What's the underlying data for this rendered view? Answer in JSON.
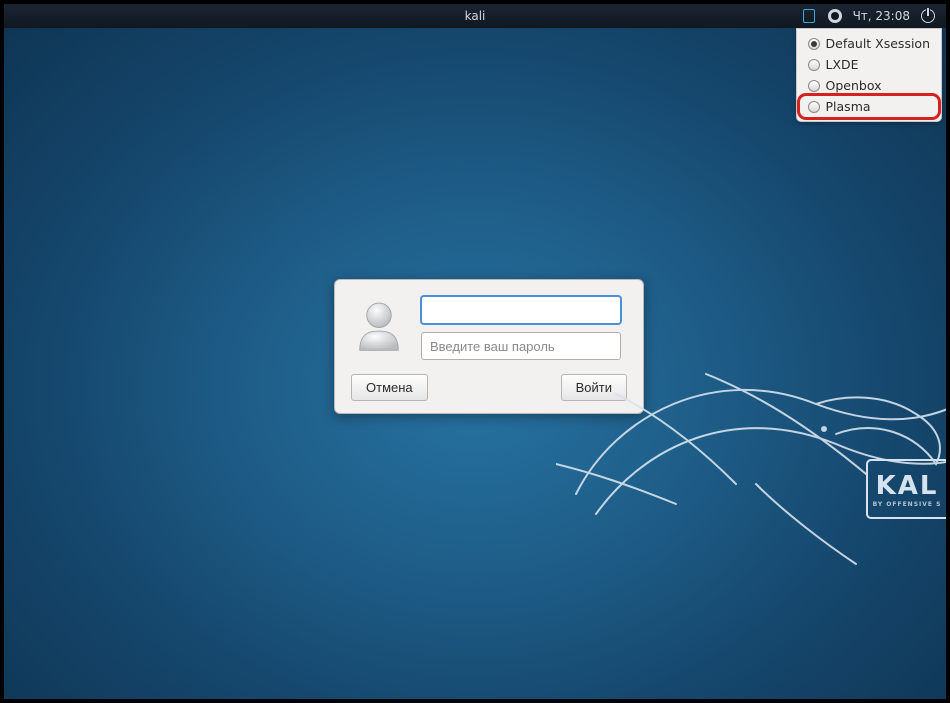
{
  "panel": {
    "hostname": "kali",
    "clock": "Чт, 23:08"
  },
  "session_menu": {
    "items": [
      {
        "label": "Default Xsession",
        "selected": true,
        "highlighted": false
      },
      {
        "label": "LXDE",
        "selected": false,
        "highlighted": false
      },
      {
        "label": "Openbox",
        "selected": false,
        "highlighted": false
      },
      {
        "label": "Plasma",
        "selected": false,
        "highlighted": true
      }
    ]
  },
  "login": {
    "username_value": "",
    "password_placeholder": "Введите ваш пароль",
    "cancel_label": "Отмена",
    "submit_label": "Войти"
  },
  "wallpaper": {
    "badge_text": "KAL",
    "badge_subtext": "BY OFFENSIVE S"
  }
}
